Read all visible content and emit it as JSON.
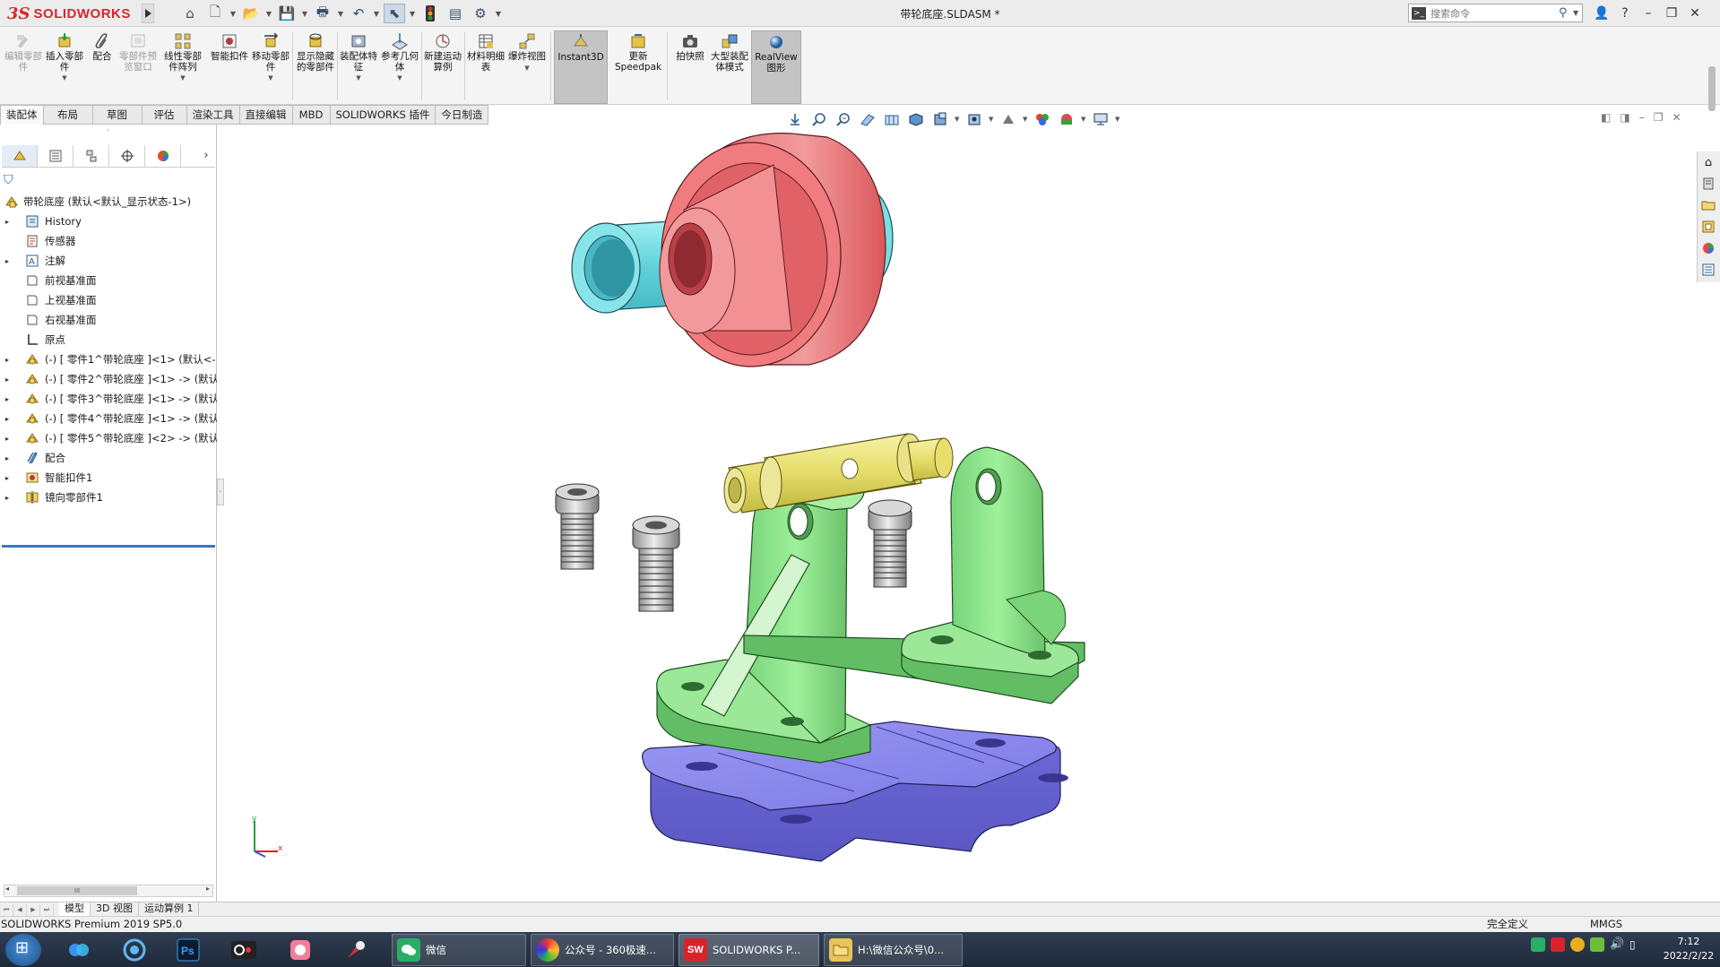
{
  "titlebar": {
    "brand_prefix": "3S",
    "brand": "SOLIDWORKS",
    "document_title": "带轮底座.SLDASM *",
    "search_placeholder": "搜索命令",
    "help_label": "?"
  },
  "ribbon": {
    "buttons": [
      {
        "id": "edit-component",
        "label": "编辑零部件",
        "disabled": true
      },
      {
        "id": "insert-component",
        "label": "插入零部件",
        "disabled": false
      },
      {
        "id": "mate",
        "label": "配合",
        "disabled": false
      },
      {
        "id": "component-preview",
        "label": "零部件预览窗口",
        "disabled": true
      },
      {
        "id": "linear-pattern",
        "label": "线性零部件阵列",
        "disabled": false
      },
      {
        "id": "smart-fasteners",
        "label": "智能扣件",
        "disabled": false
      },
      {
        "id": "move-component",
        "label": "移动零部件",
        "disabled": false
      },
      {
        "id": "show-hidden",
        "label": "显示隐藏的零部件",
        "disabled": false
      },
      {
        "id": "assembly-features",
        "label": "装配体特征",
        "disabled": false
      },
      {
        "id": "reference-geometry",
        "label": "参考几何体",
        "disabled": false
      },
      {
        "id": "new-motion-study",
        "label": "新建运动算例",
        "disabled": false
      },
      {
        "id": "bom",
        "label": "材料明细表",
        "disabled": false
      },
      {
        "id": "exploded-view",
        "label": "爆炸视图",
        "disabled": false
      },
      {
        "id": "instant3d",
        "label": "Instant3D",
        "disabled": false
      },
      {
        "id": "update-speedpak",
        "label": "更新Speedpak",
        "disabled": false
      },
      {
        "id": "snapshot",
        "label": "拍快照",
        "disabled": false
      },
      {
        "id": "large-assembly",
        "label": "大型装配体模式",
        "disabled": false
      },
      {
        "id": "realview",
        "label": "RealView图形",
        "disabled": false
      }
    ]
  },
  "command_tabs": [
    "装配体",
    "布局",
    "草图",
    "评估",
    "渲染工具",
    "直接编辑",
    "MBD",
    "SOLIDWORKS 插件",
    "今日制造"
  ],
  "tree": {
    "root": "带轮底座  (默认<默认_显示状态-1>)",
    "items": [
      {
        "label": "History",
        "icon": "history-icon",
        "expandable": true
      },
      {
        "label": "传感器",
        "icon": "sensor-icon",
        "expandable": false
      },
      {
        "label": "注解",
        "icon": "annotation-icon",
        "expandable": true
      },
      {
        "label": "前视基准面",
        "icon": "plane-icon",
        "expandable": false
      },
      {
        "label": "上视基准面",
        "icon": "plane-icon",
        "expandable": false
      },
      {
        "label": "右视基准面",
        "icon": "plane-icon",
        "expandable": false
      },
      {
        "label": "原点",
        "icon": "origin-icon",
        "expandable": false
      },
      {
        "label": "(-) [ 零件1^带轮底座 ]<1> (默认<-",
        "icon": "part-icon",
        "expandable": true
      },
      {
        "label": "(-) [ 零件2^带轮底座 ]<1> -> (默认",
        "icon": "part-icon",
        "expandable": true
      },
      {
        "label": "(-) [ 零件3^带轮底座 ]<1> -> (默认",
        "icon": "part-icon",
        "expandable": true
      },
      {
        "label": "(-) [ 零件4^带轮底座 ]<1> -> (默认",
        "icon": "part-icon",
        "expandable": true
      },
      {
        "label": "(-) [ 零件5^带轮底座 ]<2> -> (默认",
        "icon": "part-icon",
        "expandable": true
      },
      {
        "label": "配合",
        "icon": "mates-icon",
        "expandable": true
      },
      {
        "label": "智能扣件1",
        "icon": "fastener-icon",
        "expandable": true
      },
      {
        "label": "镜向零部件1",
        "icon": "mirror-component-icon",
        "expandable": true
      }
    ],
    "scroll_thumb_label": "III"
  },
  "bottom_tabs": [
    "模型",
    "3D 视图",
    "运动算例 1"
  ],
  "status": {
    "product": "SOLIDWORKS Premium 2019 SP5.0",
    "definition": "完全定义",
    "units": "MMGS"
  },
  "triad": {
    "x": "x",
    "y": "y"
  },
  "taskbar": {
    "tasks": [
      {
        "label": "微信",
        "color": "#2aae67"
      },
      {
        "label": "公众号 - 360极速...",
        "color": "#e8a320"
      },
      {
        "label": "SOLIDWORKS P...",
        "color": "#d8232a"
      },
      {
        "label": "H:\\微信公众号\\0...",
        "color": "#e7c45a"
      }
    ],
    "time": "7:12",
    "date": "2022/2/22"
  },
  "colors": {
    "pulley": "#e8787a",
    "bushing": "#7ddde4",
    "bracket": "#8fe38a",
    "base_plate": "#8a86ee",
    "shaft": "#e8e27a",
    "bolt": "#c9c9c9"
  }
}
